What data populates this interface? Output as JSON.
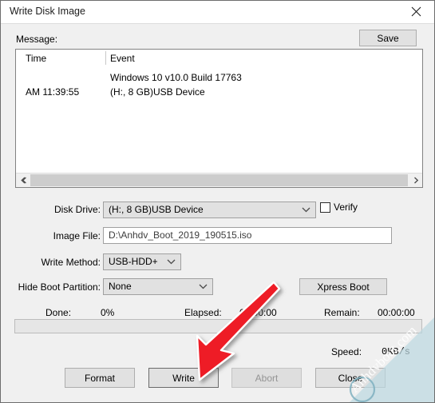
{
  "window": {
    "title": "Write Disk Image",
    "close_icon": "close-icon"
  },
  "message_section": {
    "label": "Message:",
    "save_label": "Save",
    "columns": [
      "Time",
      "Event"
    ],
    "rows": [
      {
        "time": "",
        "event": "Windows 10 v10.0 Build 17763"
      },
      {
        "time": "AM 11:39:55",
        "event": "(H:, 8 GB)USB Device"
      }
    ],
    "scroll_left_icon": "chevron-left-icon",
    "scroll_right_icon": "chevron-right-icon"
  },
  "form": {
    "disk_drive": {
      "label": "Disk Drive:",
      "value": "(H:, 8 GB)USB Device",
      "chevron": "chevron-down-icon"
    },
    "verify": {
      "label": "Verify",
      "checked": false
    },
    "image_file": {
      "label": "Image File:",
      "value": "D:\\Anhdv_Boot_2019_190515.iso"
    },
    "write_method": {
      "label": "Write Method:",
      "value": "USB-HDD+",
      "chevron": "chevron-down-icon"
    },
    "hide_boot_partition": {
      "label": "Hide Boot Partition:",
      "value": "None",
      "chevron": "chevron-down-icon"
    },
    "xpress_boot_label": "Xpress Boot"
  },
  "status": {
    "done_label": "Done:",
    "done_value": "0%",
    "elapsed_label": "Elapsed:",
    "elapsed_value": "00:00:00",
    "remain_label": "Remain:",
    "remain_value": "00:00:00",
    "progress_percent": 0,
    "speed_label": "Speed:",
    "speed_value": "0KB/s"
  },
  "buttons": {
    "format": "Format",
    "write": "Write",
    "abort": "Abort",
    "close": "Close"
  },
  "annotation": {
    "arrow_color": "#ee1c25",
    "arrow_outline": "#ffffff"
  },
  "watermark": {
    "text": "Anhdvboot.com",
    "color": "#bcd8e0"
  }
}
